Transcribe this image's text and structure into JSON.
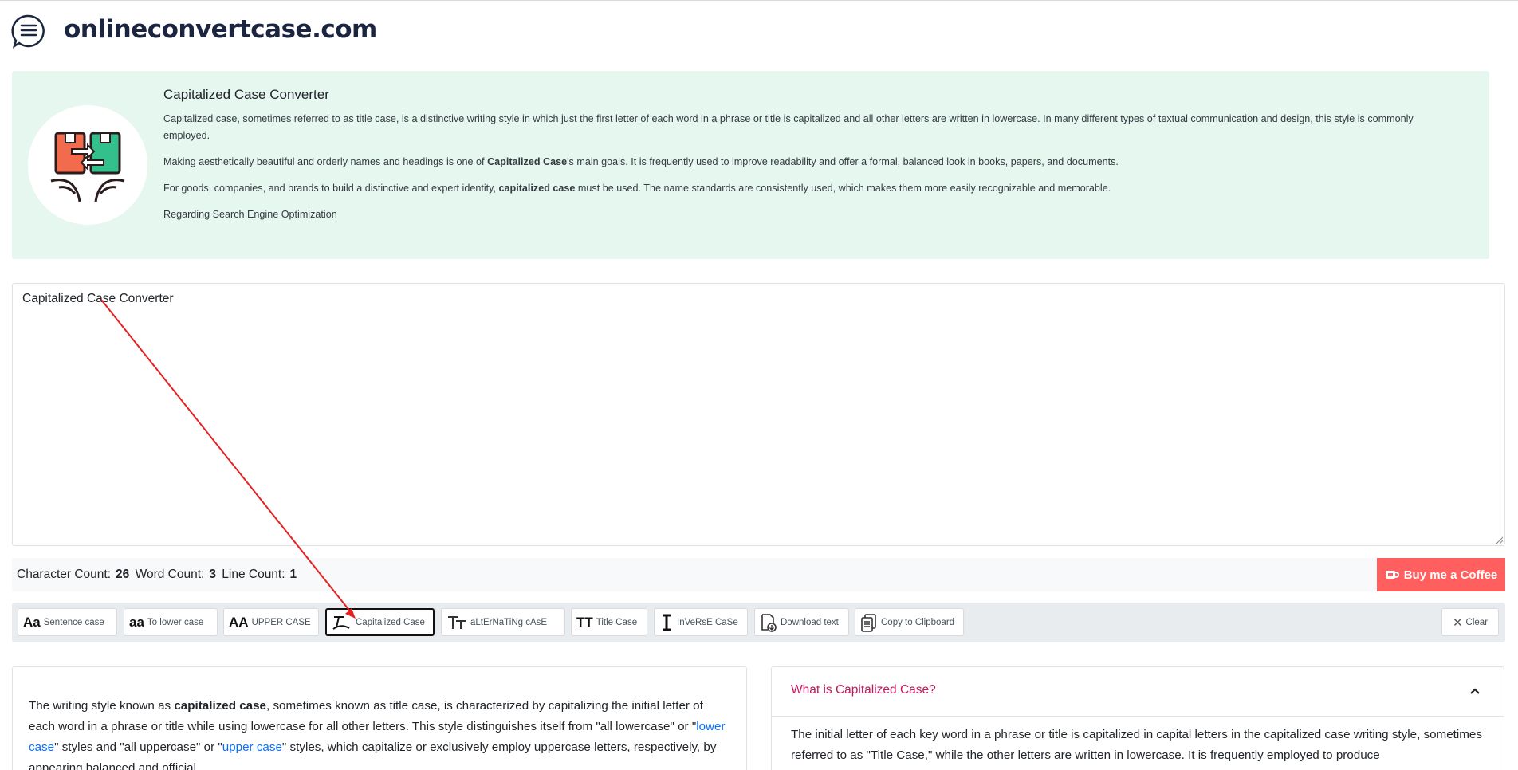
{
  "header": {
    "brand": "onlineconvertcase.com",
    "menu_icon": "menu-chat-icon"
  },
  "info": {
    "title": "Capitalized Case Converter",
    "p1": "Capitalized case, sometimes referred to as title case, is a distinctive writing style in which just the first letter of each word in a phrase or title is capitalized and all other letters are written in lowercase. In many different types of textual communication and design, this style is commonly employed.",
    "p2_before": "Making aesthetically beautiful and orderly names and headings is one of ",
    "p2_bold": "Capitalized Case",
    "p2_after": "'s main goals. It is frequently used to improve readability and offer a formal, balanced look in books, papers, and documents.",
    "p3_before": "For goods, companies, and brands to build a distinctive and expert identity, ",
    "p3_bold": "capitalized case",
    "p3_after": " must be used. The name standards are consistently used, which makes them more easily recognizable and memorable.",
    "p4": "Regarding Search Engine Optimization",
    "logo_icon": "box-exchange-icon"
  },
  "editor": {
    "value": "Capitalized Case Converter"
  },
  "counts": {
    "char_label": "Character Count:",
    "char_value": "26",
    "word_label": "Word Count:",
    "word_value": "3",
    "line_label": "Line Count:",
    "line_value": "1"
  },
  "coffee": {
    "label": "Buy me a Coffee",
    "color": "#ff5f5f"
  },
  "toolbar": {
    "sentence": "Sentence case",
    "lower": "To lower case",
    "upper": "UPPER CASE",
    "capitalized": "Capitalized Case",
    "alternating": "aLtErNaTiNg cAsE",
    "title": "Title Case",
    "inverse": "InVeRsE CaSe",
    "download": "Download text",
    "copy": "Copy to Clipboard",
    "clear": "Clear",
    "sentence_glyph": "Aa",
    "lower_glyph": "aa",
    "upper_glyph": "AA",
    "title_glyph": "TT"
  },
  "content": {
    "t1": "The writing style known as ",
    "b1": "capitalized case",
    "t2": ", sometimes known as title case, is characterized by capitalizing the initial letter of each word in a phrase or title while using lowercase for all other letters. This style distinguishes itself from \"all lowercase\" or \"",
    "link1": "lower case",
    "t3": "\" styles and \"all uppercase\" or \"",
    "link2": "upper case",
    "t4": "\" styles, which capitalize or exclusively employ uppercase letters, respectively, by appearing balanced and official."
  },
  "faq": {
    "question": "What is Capitalized Case?",
    "answer": "The initial letter of each key word in a phrase or title is capitalized in capital letters in the capitalized case writing style, sometimes referred to as \"Title Case,\" while the other letters are written in lowercase. It is frequently employed to produce"
  },
  "colors": {
    "panel_bg": "#e6f7f0",
    "brand": "#1c2540",
    "faq_question": "#c2185b",
    "link": "#0d6efd",
    "annotation_arrow": "#e52121"
  }
}
